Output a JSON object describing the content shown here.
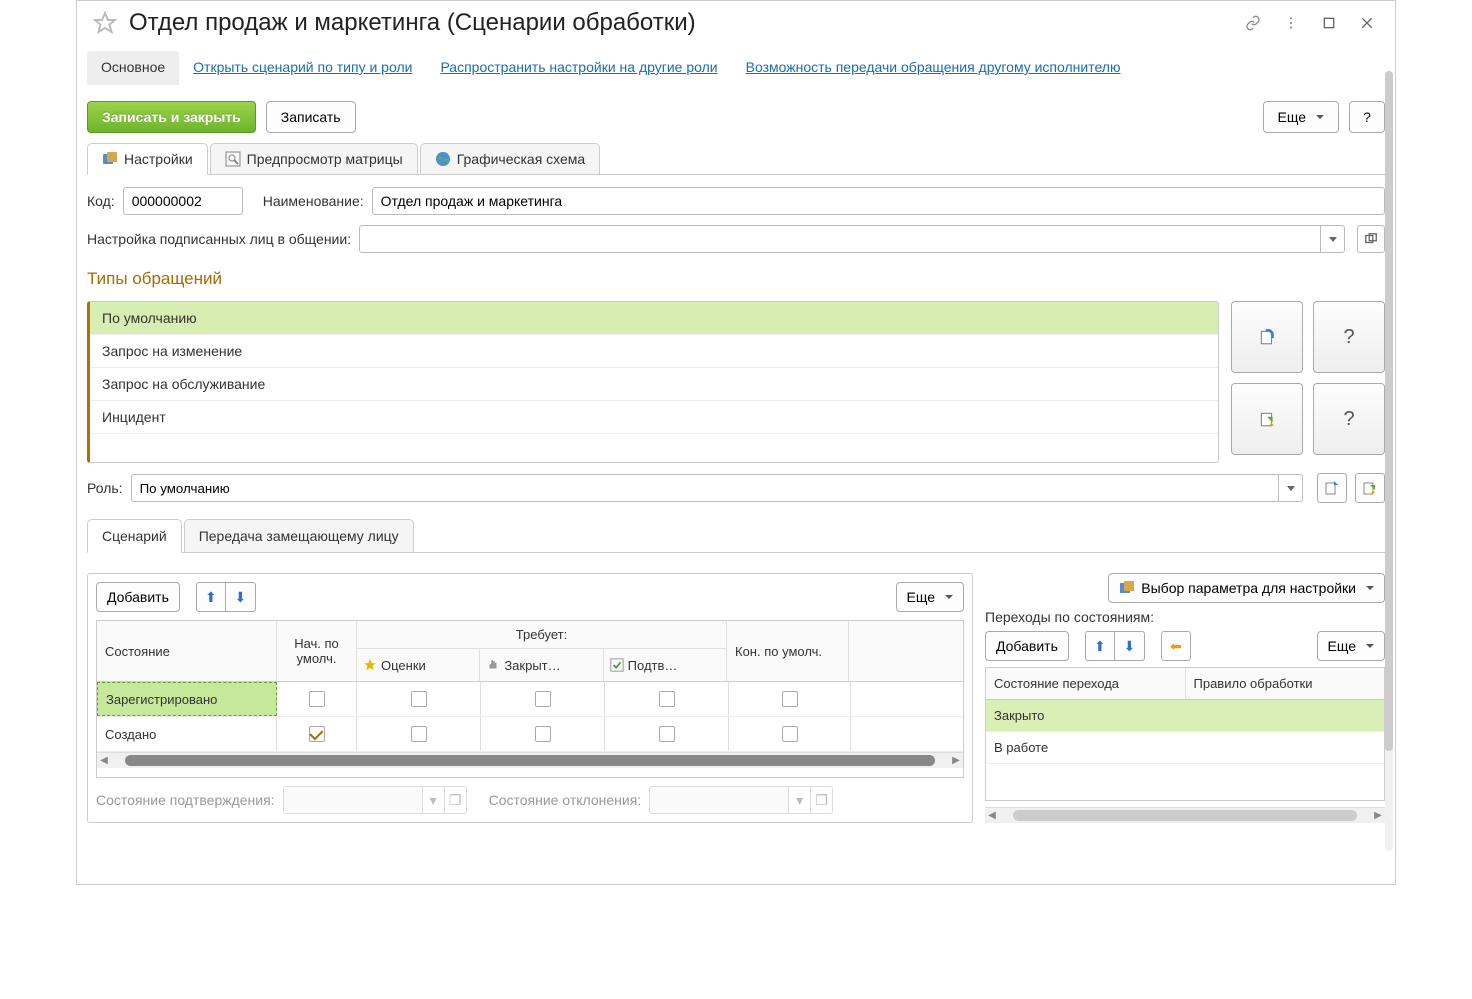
{
  "title": "Отдел продаж и маркетинга (Сценарии обработки)",
  "nav": {
    "main": "Основное",
    "open_by_type": "Открыть сценарий по типу и роли",
    "spread_settings": "Распространить настройки на другие роли",
    "transfer_possibility": "Возможность передачи обращения другому исполнителю"
  },
  "buttons": {
    "save_close": "Записать и закрыть",
    "save": "Записать",
    "more": "Еще",
    "help": "?",
    "add": "Добавить",
    "param_select": "Выбор параметра для настройки"
  },
  "page_tabs": {
    "settings": "Настройки",
    "preview": "Предпросмотр матрицы",
    "graphic": "Графическая схема"
  },
  "fields": {
    "code_label": "Код:",
    "code_value": "000000002",
    "name_label": "Наименование:",
    "name_value": "Отдел продаж и маркетинга",
    "signed_label": "Настройка подписанных лиц в общении:",
    "signed_value": "",
    "role_label": "Роль:",
    "role_value": "По умолчанию",
    "confirm_state_label": "Состояние подтверждения:",
    "reject_state_label": "Состояние отклонения:"
  },
  "sections": {
    "types_title": "Типы обращений"
  },
  "types": {
    "items": [
      "По умолчанию",
      "Запрос на изменение",
      "Запрос на обслуживание",
      "Инцидент"
    ],
    "selected_index": 0
  },
  "sub_tabs": {
    "scenario": "Сценарий",
    "transfer": "Передача замещающему лицу"
  },
  "grid": {
    "col_state": "Состояние",
    "col_start": "Нач. по умолч.",
    "col_requires": "Требует:",
    "col_rating": "Оценки",
    "col_closing": "Закрыт…",
    "col_confirm": "Подтв…",
    "col_end": "Кон. по умолч.",
    "rows": [
      {
        "state": "Зарегистрировано",
        "start": false,
        "rating": false,
        "closing": false,
        "confirm": false,
        "end": false,
        "selected": true
      },
      {
        "state": "Создано",
        "start": true,
        "rating": false,
        "closing": false,
        "confirm": false,
        "end": false,
        "selected": false
      }
    ]
  },
  "right": {
    "title": "Переходы по состояниям:",
    "col_state": "Состояние перехода",
    "col_rule": "Правило обработки",
    "rows": [
      {
        "state": "Закрыто",
        "rule": "",
        "selected": true
      },
      {
        "state": "В работе",
        "rule": "",
        "selected": false
      }
    ]
  }
}
